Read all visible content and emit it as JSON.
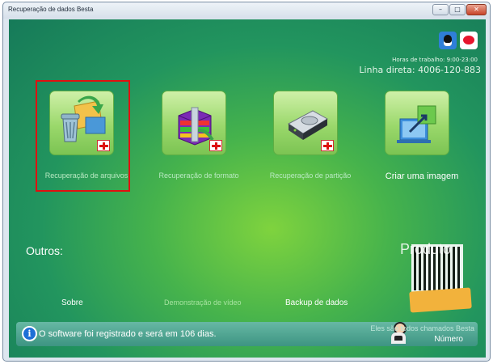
{
  "window": {
    "title": "Recuperação de dados Besta",
    "controls": {
      "minimize_icon": "minimize-icon",
      "maximize_icon": "maximize-icon",
      "close_icon": "close-icon"
    }
  },
  "contact": {
    "social_icons": [
      "qq-icon",
      "weibo-icon"
    ],
    "hours": "Horas de trabalho: 9:00-23:00",
    "hotline": "Linha direta: 4006-120-883"
  },
  "features": [
    {
      "label": "Recuperação de arquivos",
      "icon": "recycle-bin-icon",
      "selected": true
    },
    {
      "label": "Recuperação de formato",
      "icon": "archive-icon",
      "selected": false
    },
    {
      "label": "Recuperação de partição",
      "icon": "hard-drive-icon",
      "selected": false
    },
    {
      "label": "Criar uma imagem",
      "icon": "image-export-icon",
      "selected": false
    }
  ],
  "others": {
    "title": "Outros:",
    "links": [
      "Sobre",
      "Demonstração de vídeo",
      "Backup de dados"
    ]
  },
  "promo": {
    "title": "Produto"
  },
  "status": {
    "message": "O software foi registrado e será em 106 dias.",
    "support_line": "Eles são todos chamados Besta",
    "support_number": "Número"
  },
  "colors": {
    "background_center": "#7fd33e",
    "background_edge": "#167a59",
    "selection_border": "#e01010",
    "info_icon": "#1d6fd6"
  }
}
